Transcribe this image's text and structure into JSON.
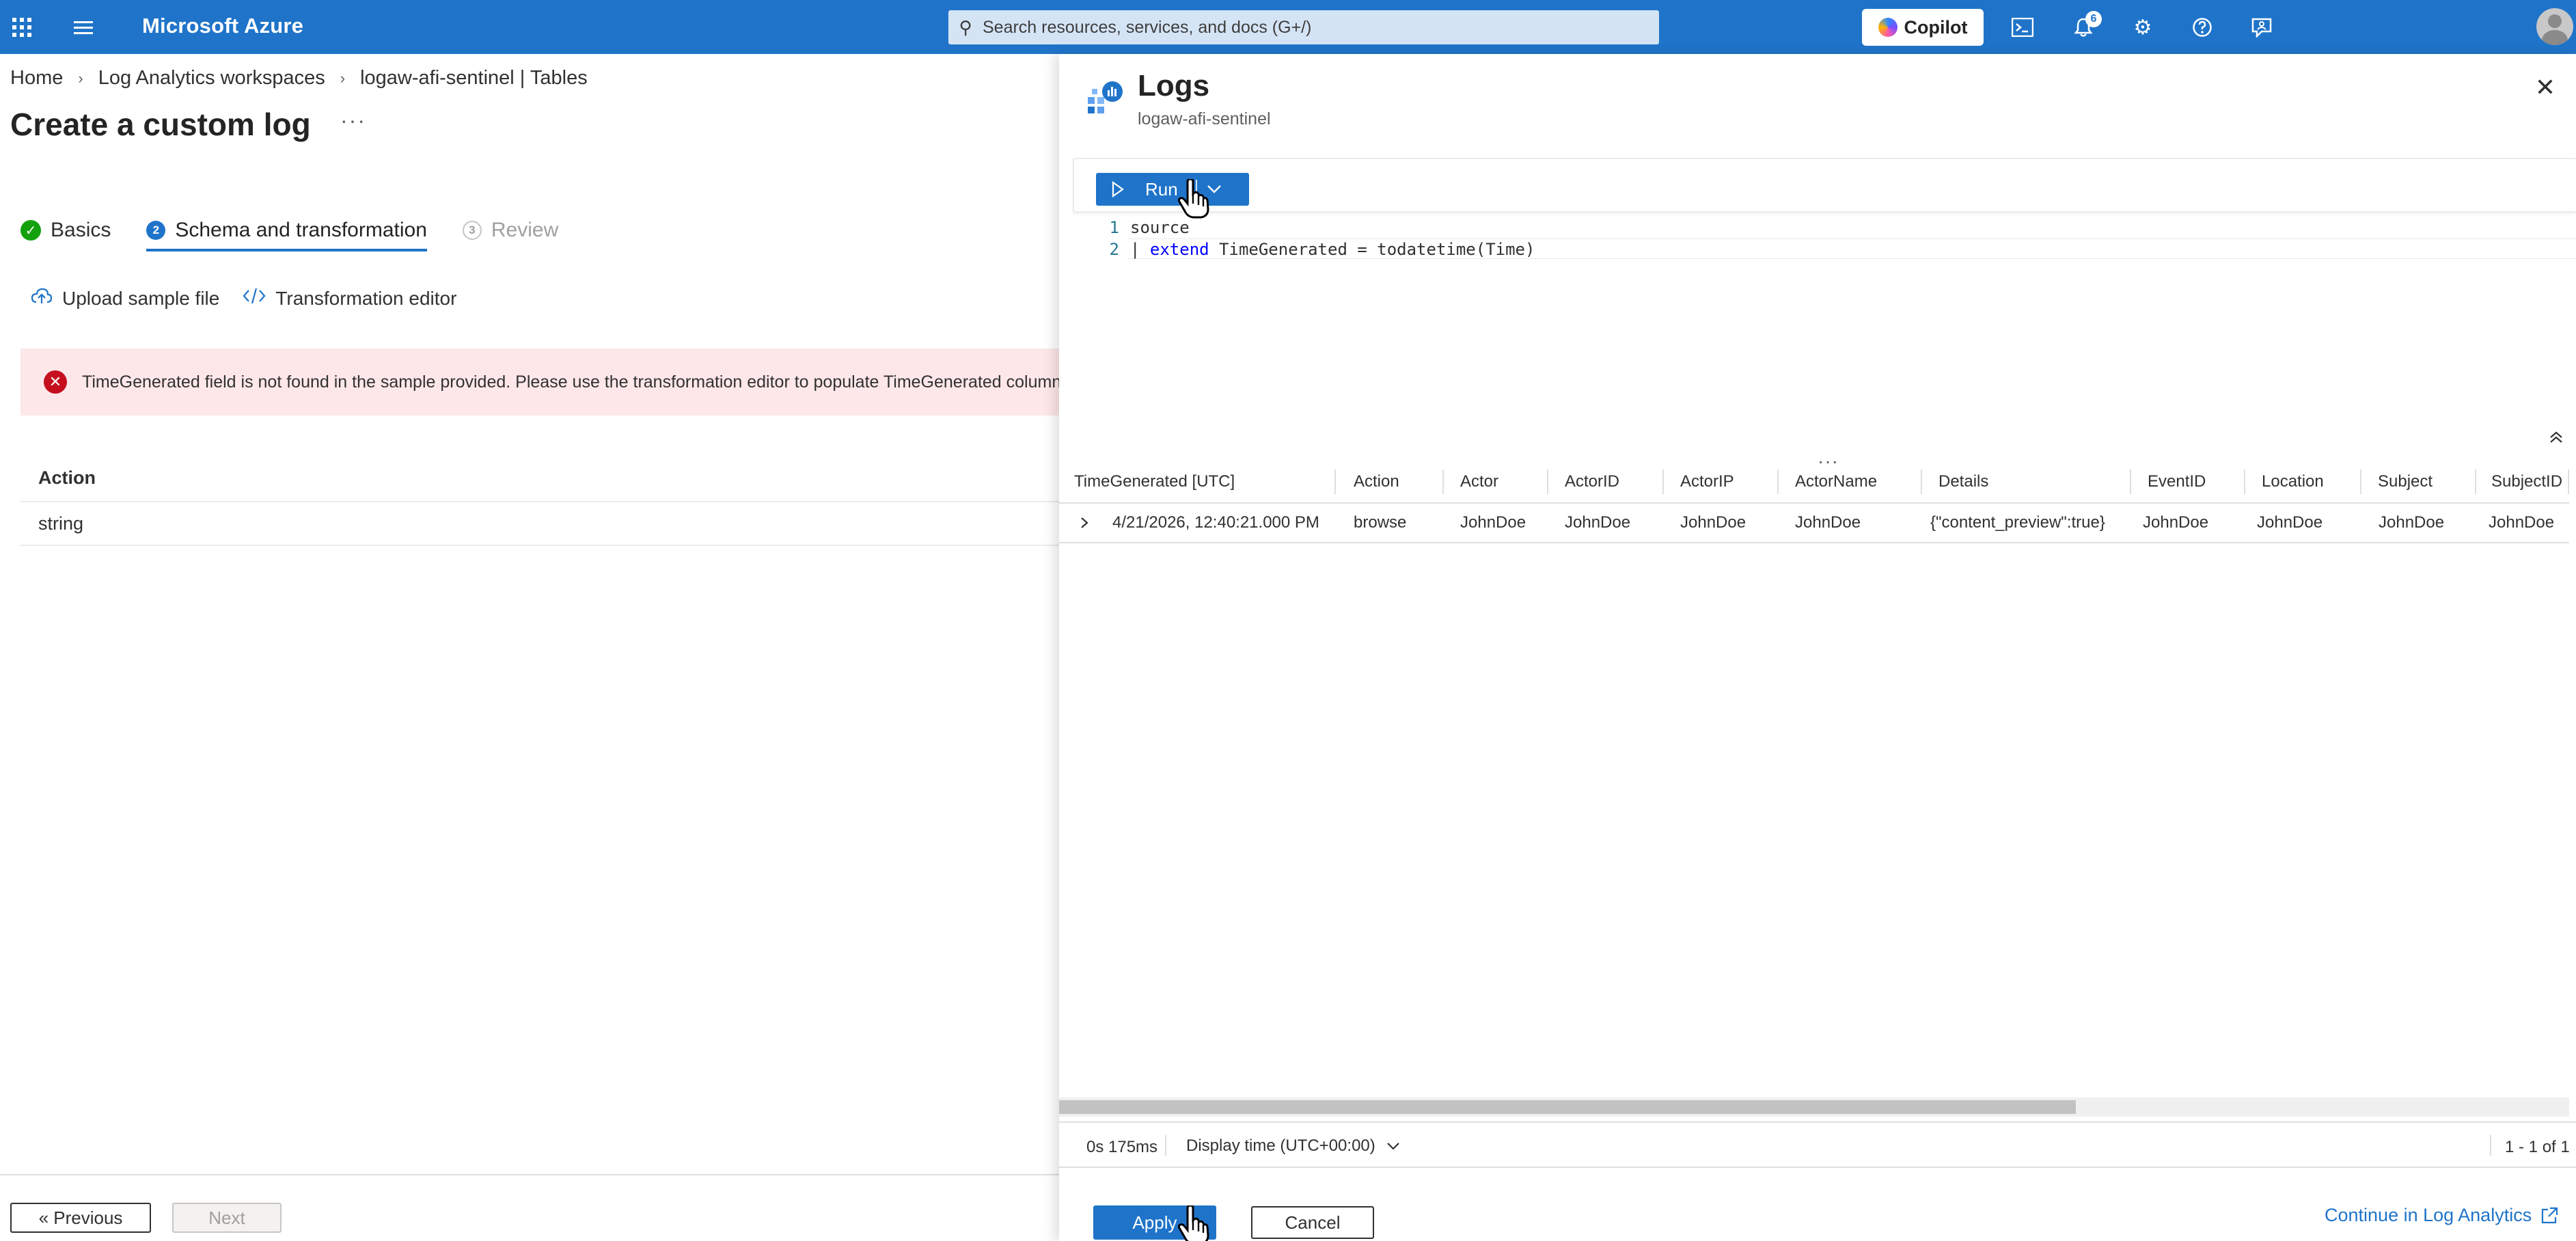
{
  "topbar": {
    "brand": "Microsoft Azure",
    "search_placeholder": "Search resources, services, and docs (G+/)",
    "copilot_label": "Copilot",
    "notifications_count": "6",
    "accent": "#1f74c9"
  },
  "breadcrumb": [
    "Home",
    "Log Analytics workspaces",
    "logaw-afi-sentinel | Tables"
  ],
  "page": {
    "title": "Create a custom log",
    "more": "···"
  },
  "tabs": [
    {
      "label": "Basics",
      "step": "",
      "state": "complete"
    },
    {
      "label": "Schema and transformation",
      "step": "2",
      "state": "active"
    },
    {
      "label": "Review",
      "step": "3",
      "state": "disabled"
    }
  ],
  "actions": {
    "upload": "Upload sample file",
    "transform": "Transformation editor"
  },
  "error": {
    "message": "TimeGenerated field is not found in the sample provided. Please use the transformation editor to populate TimeGenerated column in the"
  },
  "left_table": {
    "header": "Action",
    "row": "string"
  },
  "footer": {
    "previous": "« Previous",
    "next": "Next"
  },
  "logs": {
    "title": "Logs",
    "subtitle": "logaw-afi-sentinel",
    "run_label": "Run",
    "code_lines": [
      {
        "num": "1",
        "text": "source"
      },
      {
        "num": "2",
        "prefix": "| ",
        "keyword": "extend",
        "rest": " TimeGenerated = todatetime(Time)"
      }
    ],
    "columns": [
      "TimeGenerated [UTC]",
      "Action",
      "Actor",
      "ActorID",
      "ActorIP",
      "ActorName",
      "Details",
      "EventID",
      "Location",
      "Subject",
      "SubjectID"
    ],
    "row": [
      "4/21/2026, 12:40:21.000 PM",
      "browse",
      "JohnDoe",
      "JohnDoe",
      "JohnDoe",
      "JohnDoe",
      "{\"content_preview\":true}",
      "JohnDoe",
      "JohnDoe",
      "JohnDoe",
      "JohnDoe"
    ],
    "duration": "0s 175ms",
    "display_time": "Display time (UTC+00:00)",
    "count": "1 - 1 of 1",
    "apply": "Apply",
    "cancel": "Cancel",
    "continue": "Continue in Log Analytics"
  }
}
